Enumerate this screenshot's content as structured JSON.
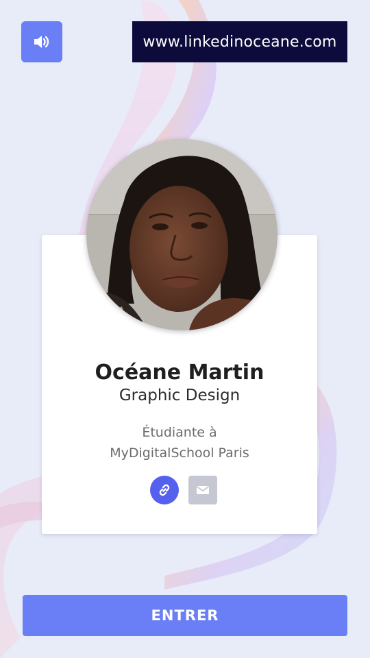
{
  "header": {
    "sound_icon": "volume-icon",
    "website_url": "www.linkedinoceane.com"
  },
  "profile": {
    "name": "Océane Martin",
    "role": "Graphic Design",
    "description_line1": "Étudiante à",
    "description_line2": "MyDigitalSchool Paris",
    "avatar_icon": "profile-photo"
  },
  "actions": {
    "link_icon": "link-icon",
    "mail_icon": "mail-icon"
  },
  "footer": {
    "enter_label": "ENTRER"
  },
  "colors": {
    "background": "#e8ebf8",
    "accent": "#6a7ef5",
    "url_badge": "#0d0b3c",
    "link_button": "#5560ee",
    "mail_button": "#c5c8d2"
  }
}
